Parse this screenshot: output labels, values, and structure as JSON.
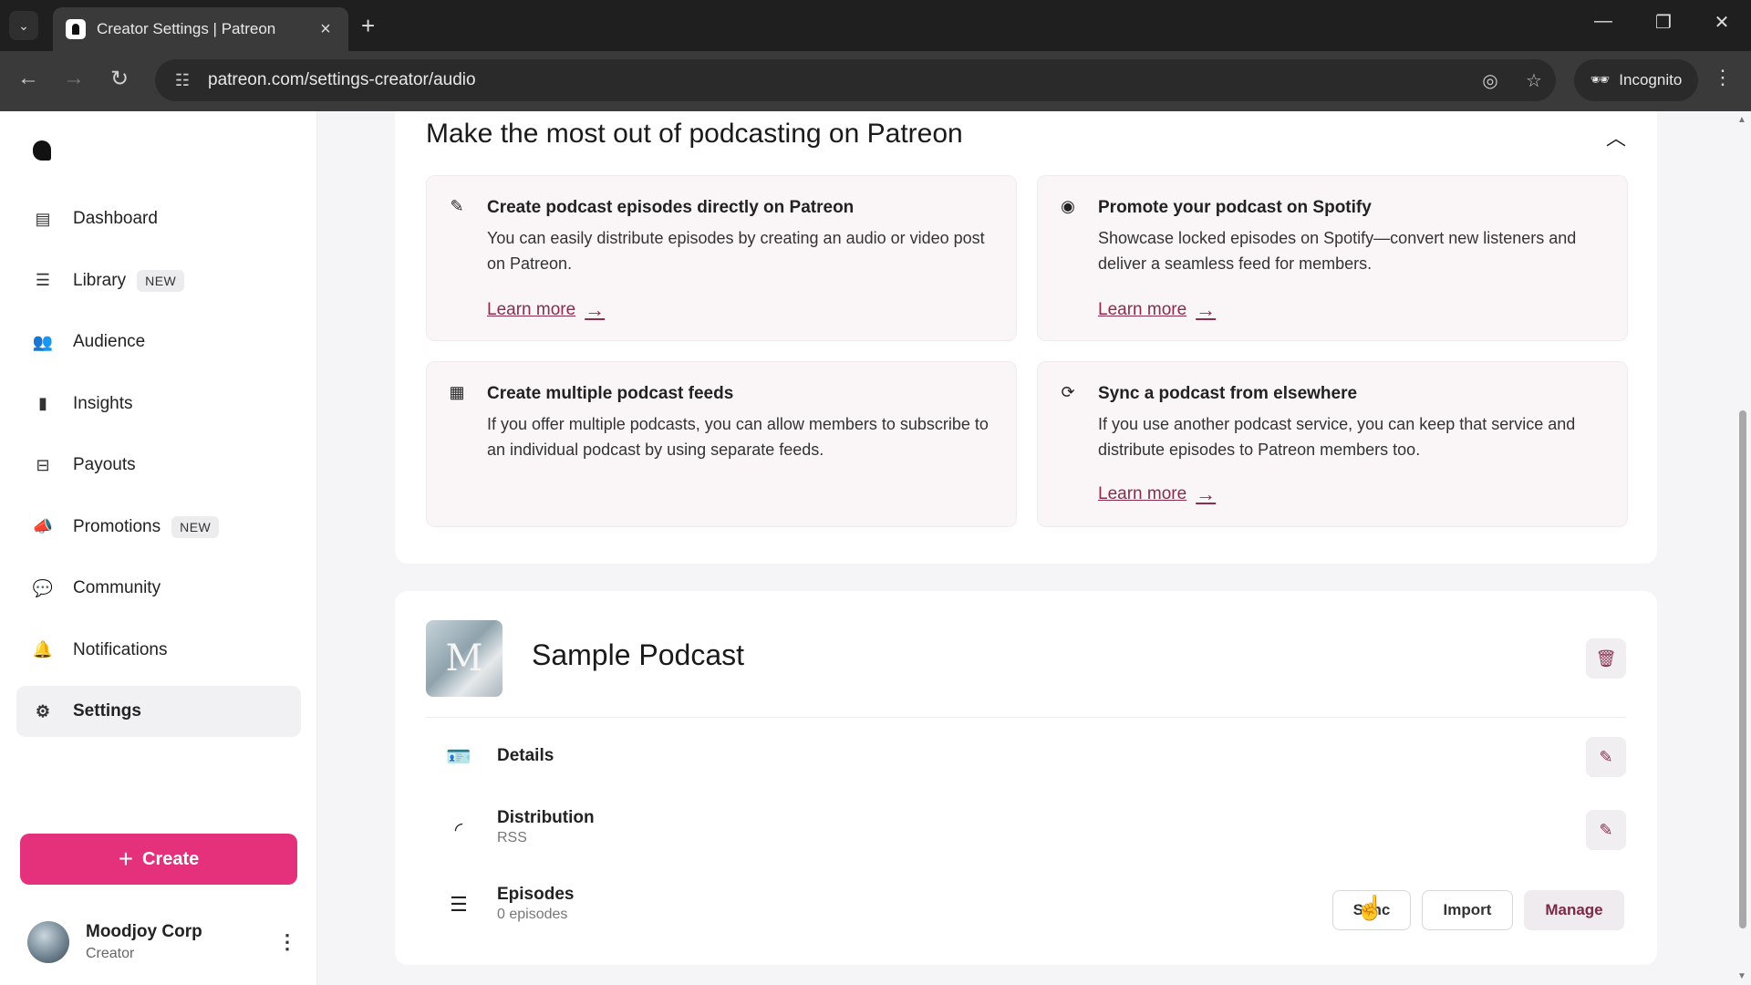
{
  "browser": {
    "tab_title": "Creator Settings | Patreon",
    "url": "patreon.com/settings-creator/audio",
    "incognito_label": "Incognito"
  },
  "sidebar": {
    "items": [
      {
        "label": "Dashboard",
        "icon": "dashboard-icon",
        "badge": ""
      },
      {
        "label": "Library",
        "icon": "library-icon",
        "badge": "NEW"
      },
      {
        "label": "Audience",
        "icon": "audience-icon",
        "badge": ""
      },
      {
        "label": "Insights",
        "icon": "insights-icon",
        "badge": ""
      },
      {
        "label": "Payouts",
        "icon": "payouts-icon",
        "badge": ""
      },
      {
        "label": "Promotions",
        "icon": "megaphone-icon",
        "badge": "NEW"
      },
      {
        "label": "Community",
        "icon": "community-icon",
        "badge": ""
      },
      {
        "label": "Notifications",
        "icon": "bell-icon",
        "badge": ""
      },
      {
        "label": "Settings",
        "icon": "gear-icon",
        "badge": "",
        "active": true
      }
    ],
    "create_label": "Create",
    "profile": {
      "name": "Moodjoy Corp",
      "role": "Creator"
    }
  },
  "promo": {
    "title": "Make the most out of podcasting on Patreon",
    "features": [
      {
        "icon": "edit-icon",
        "title": "Create podcast episodes directly on Patreon",
        "body": "You can easily distribute episodes by creating an audio or video post on Patreon.",
        "link": "Learn more"
      },
      {
        "icon": "spotify-icon",
        "title": "Promote your podcast on Spotify",
        "body": "Showcase locked episodes on Spotify—convert new listeners and deliver a seamless feed for members.",
        "link": "Learn more"
      },
      {
        "icon": "grid-icon",
        "title": "Create multiple podcast feeds",
        "body": "If you offer multiple podcasts, you can allow members to subscribe to an individual podcast by using separate feeds.",
        "link": ""
      },
      {
        "icon": "sync-icon",
        "title": "Sync a podcast from elsewhere",
        "body": "If you use another podcast service, you can keep that service and distribute episodes to Patreon members too.",
        "link": "Learn more"
      }
    ]
  },
  "podcast": {
    "name": "Sample Podcast",
    "details_label": "Details",
    "distribution_label": "Distribution",
    "distribution_sub": "RSS",
    "episodes_label": "Episodes",
    "episodes_sub": "0 episodes",
    "sync_label": "Sync",
    "import_label": "Import",
    "manage_label": "Manage"
  },
  "colors": {
    "brand_pink": "#e5307b",
    "link": "#8a2c4a"
  }
}
